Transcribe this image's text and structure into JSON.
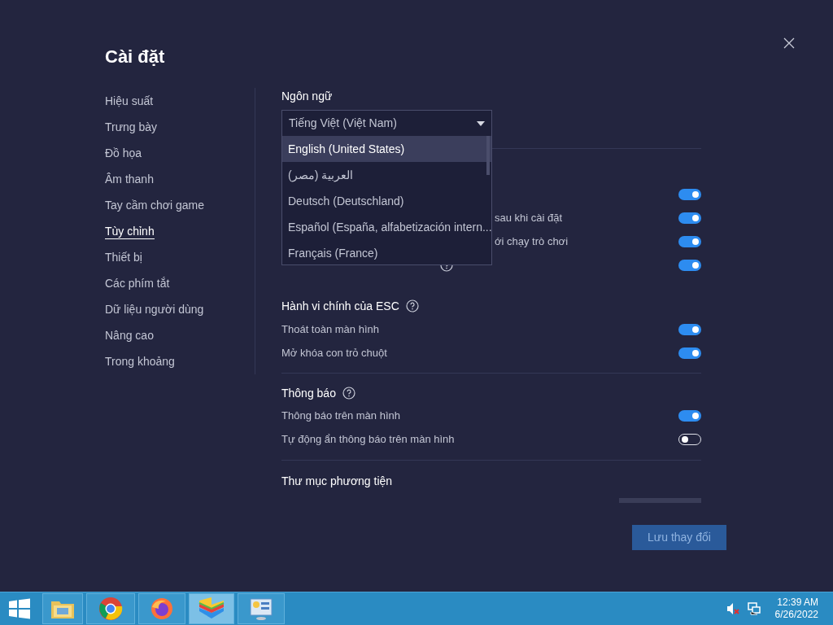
{
  "title": "Cài đặt",
  "sidebar": {
    "items": [
      {
        "label": "Hiệu suất",
        "selected": false
      },
      {
        "label": "Trưng bày",
        "selected": false
      },
      {
        "label": "Đồ họa",
        "selected": false
      },
      {
        "label": "Âm thanh",
        "selected": false
      },
      {
        "label": "Tay cầm chơi game",
        "selected": false
      },
      {
        "label": "Tùy chỉnh",
        "selected": true
      },
      {
        "label": "Thiết bị",
        "selected": false
      },
      {
        "label": "Các phím tắt",
        "selected": false
      },
      {
        "label": "Dữ liệu người dùng",
        "selected": false
      },
      {
        "label": "Nâng cao",
        "selected": false
      },
      {
        "label": "Trong khoảng",
        "selected": false
      }
    ]
  },
  "language": {
    "label": "Ngôn ngữ",
    "value": "Tiếng Việt (Việt Nam)",
    "expanded": true,
    "options": [
      {
        "label": "English (United States)",
        "selected": true
      },
      {
        "label": "العربية (مصر)",
        "selected": false
      },
      {
        "label": "Deutsch (Deutschland)",
        "selected": false
      },
      {
        "label": "Español (España, alfabetización intern...",
        "selected": false
      },
      {
        "label": "Français (France)",
        "selected": false
      }
    ]
  },
  "general_rows": [
    {
      "kind": "covered",
      "on": true
    },
    {
      "kind": "covered",
      "text": "sau khi cài đặt",
      "on": true
    },
    {
      "kind": "covered",
      "text": "ới chạy trò chơi",
      "on": true
    },
    {
      "kind": "help",
      "on": true
    }
  ],
  "sections": [
    {
      "title": "Hành vi chính của ESC",
      "help": true,
      "rows": [
        {
          "label": "Thoát toàn màn hình",
          "on": true
        },
        {
          "label": "Mở khóa con trỏ chuột",
          "on": true
        }
      ]
    },
    {
      "title": "Thông báo",
      "help": true,
      "rows": [
        {
          "label": "Thông báo trên màn hình",
          "on": true
        },
        {
          "label": "Tự động ẩn thông báo trên màn hình",
          "on": false
        }
      ]
    }
  ],
  "media_folder": {
    "title": "Thư mục phương tiện"
  },
  "save_button": {
    "label": "Lưu thay đổi",
    "disabled": true
  },
  "taskbar": {
    "apps": [
      {
        "kind": "folder",
        "selected": false
      },
      {
        "kind": "chrome",
        "selected": false
      },
      {
        "kind": "firefox",
        "selected": false
      },
      {
        "kind": "layers",
        "selected": true
      },
      {
        "kind": "panel",
        "selected": false
      }
    ],
    "time": "12:39 AM",
    "date": "6/26/2022"
  }
}
